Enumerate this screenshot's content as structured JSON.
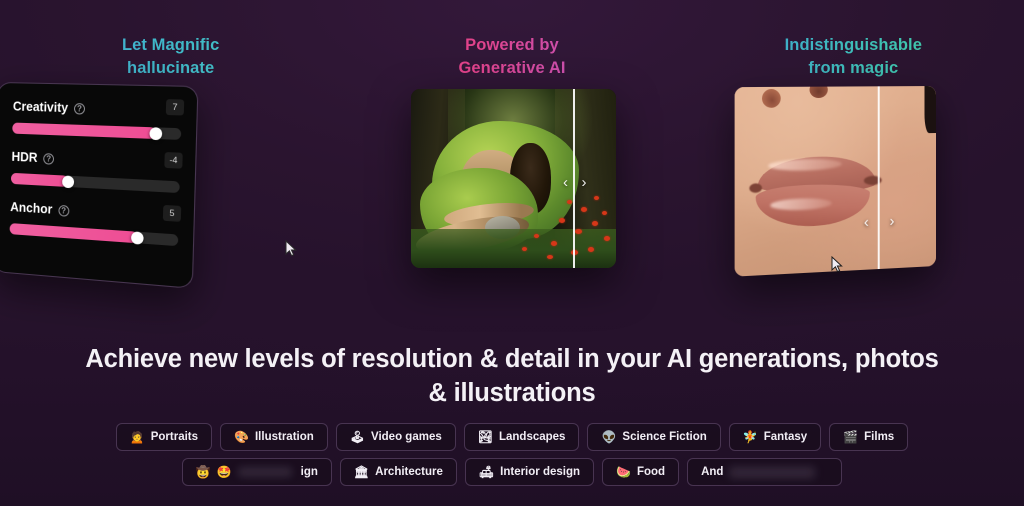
{
  "features": [
    {
      "caption_line1": "Let Magnific",
      "caption_line2": "hallucinate",
      "caption_gradient": [
        "#4aa3e0",
        "#46c8c0"
      ],
      "type": "sliders",
      "sliders": [
        {
          "label": "Creativity",
          "value": "7",
          "fill_percent": 86,
          "help": "?"
        },
        {
          "label": "HDR",
          "value": "-4",
          "fill_percent": 35,
          "help": "?"
        },
        {
          "label": "Anchor",
          "value": "5",
          "fill_percent": 77,
          "help": "?"
        }
      ]
    },
    {
      "caption_line1": "Powered by",
      "caption_line2": "Generative AI",
      "caption_gradient": [
        "#e8407a",
        "#b05fd6"
      ],
      "type": "comparison",
      "image_alt": "Mossy tree roots in a green forest with red flowers",
      "divider_percent": 79,
      "prev_arrow": "‹",
      "next_arrow": "›"
    },
    {
      "caption_line1": "Indistinguishable",
      "caption_line2": "from magic",
      "caption_gradient": [
        "#3f9ddc",
        "#43cf8e"
      ],
      "type": "comparison",
      "image_alt": "Close up of a person's lips and lower face",
      "divider_percent": 70,
      "prev_arrow": "‹",
      "next_arrow": "›"
    }
  ],
  "headline": "Achieve new levels of resolution & detail in your AI generations, photos & illustrations",
  "tags": {
    "row1": [
      {
        "emoji": "🙍",
        "label": "Portraits"
      },
      {
        "emoji": "🎨",
        "label": "Illustration"
      },
      {
        "emoji": "🕹",
        "label": "Video games"
      },
      {
        "emoji": "🏞",
        "label": "Landscapes"
      },
      {
        "emoji": "👽",
        "label": "Science Fiction"
      },
      {
        "emoji": "🧚",
        "label": "Fantasy"
      },
      {
        "emoji": "🎬",
        "label": "Films"
      }
    ],
    "row2": [
      {
        "emoji": "🤠",
        "emoji2": "🤩",
        "label": "ign",
        "blurred": true
      },
      {
        "emoji": "🏛",
        "label": "Architecture"
      },
      {
        "emoji": "🛋",
        "label": "Interior design"
      },
      {
        "emoji": "🍉",
        "label": "Food"
      },
      {
        "emoji": "",
        "label": "And",
        "truncated": true
      }
    ]
  },
  "colors": {
    "background": "#2a1730",
    "accent_pink": "#ee4d94",
    "card_background": "#080808",
    "pill_border": "#a082b4"
  }
}
